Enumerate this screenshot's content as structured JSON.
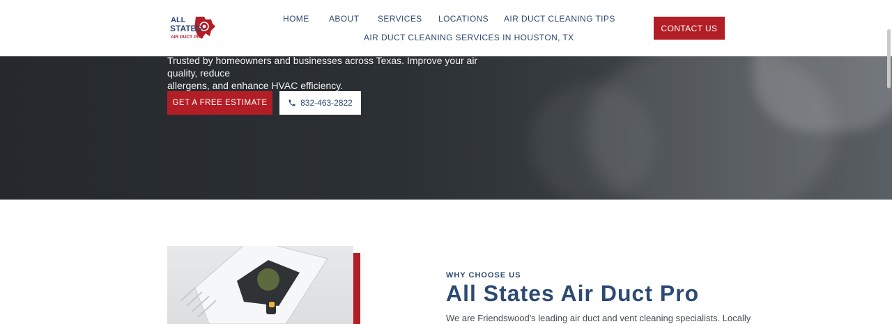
{
  "nav": {
    "logo_lines": [
      "ALL",
      "STATES",
      "AIR DUCT PRO"
    ],
    "links": [
      "HOME",
      "ABOUT",
      "SERVICES",
      "LOCATIONS",
      "AIR DUCT CLEANING TIPS",
      "AIR DUCT CLEANING SERVICES IN HOUSTON, TX"
    ],
    "contact_label": "CONTACT US"
  },
  "hero": {
    "body_line_1": "Trusted by homeowners and businesses across Texas. Improve your air quality, reduce",
    "body_line_2": "allergens, and enhance HVAC efficiency.",
    "estimate_label": "GET A FREE ESTIMATE",
    "phone": "832-463-2822"
  },
  "about": {
    "eyebrow": "WHY CHOOSE US",
    "title": "All States Air Duct Pro",
    "body_line_1": "We are Friendswood's leading air duct and vent cleaning specialists. Locally"
  },
  "colors": {
    "brand_red": "#b31d25",
    "brand_navy": "#2c4a73",
    "hero_dark": "#2b3034"
  }
}
